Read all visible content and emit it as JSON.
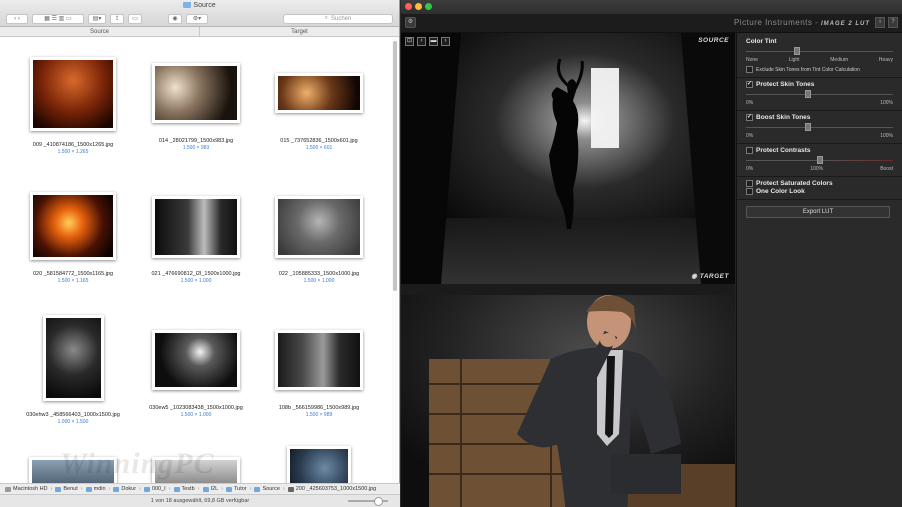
{
  "finder": {
    "title": "Source",
    "search_placeholder": "Suchen",
    "panes": [
      "Source",
      "Target"
    ],
    "files": [
      {
        "name": "009 _410874186_1500x1265.jpg",
        "dims": "1.500 × 1.265"
      },
      {
        "name": "014 _28021799_1500x983.jpg",
        "dims": "1.500 × 983"
      },
      {
        "name": "015 _737652836_1500x601.jpg",
        "dims": "1.500 × 601"
      },
      {
        "name": "020 _581584772_1500x1165.jpg",
        "dims": "1.500 × 1.165"
      },
      {
        "name": "021 _476690812_l2l_1500x1000.jpg",
        "dims": "1.500 × 1.000"
      },
      {
        "name": "022 _105885333_1500x1000.jpg",
        "dims": "1.500 × 1.000"
      },
      {
        "name": "030ehw3 _458566403_1000x1500.jpg",
        "dims": "1.000 × 1.500"
      },
      {
        "name": "030ew5 _1023083438_1500x1000.jpg",
        "dims": "1.500 × 1.000"
      },
      {
        "name": "108b _566159986_1500x989.jpg",
        "dims": "1.500 × 989"
      }
    ],
    "path": [
      "Macintosh HD",
      "Benut",
      "mdin",
      "Dokur",
      "000_I",
      "Testb",
      "I2L",
      "Tutor",
      "Source",
      "200 _425603753_1000x1500.jpg"
    ],
    "status": "1 von 18 ausgewählt, 69,8 GB verfügbar",
    "watermark": "WinningPC"
  },
  "lut": {
    "brand": "Picture Instruments",
    "product": "IMAGE 2 LUT",
    "header_buttons": [
      "i",
      "?"
    ],
    "source_label": "SOURCE",
    "target_label": "TARGET",
    "panel": {
      "color_tint": {
        "title": "Color Tint",
        "labels": [
          "None",
          "Light",
          "Medium",
          "Heavy"
        ],
        "value": 0.35,
        "exclude_label": "Exclude Skin Tones from Tint Color Calculation",
        "exclude_checked": false
      },
      "protect_skin": {
        "title": "Protect Skin Tones",
        "checked": true,
        "min": "0%",
        "max": "100%",
        "value": 0.42
      },
      "boost_skin": {
        "title": "Boost Skin Tones",
        "checked": true,
        "min": "0%",
        "max": "100%",
        "value": 0.42
      },
      "protect_contrasts": {
        "title": "Protect Contrasts",
        "checked": false,
        "min": "0%",
        "mid": "100%",
        "max": "Boost",
        "value": 0.5
      },
      "protect_saturated": {
        "title": "Protect Saturated Colors",
        "checked": false
      },
      "one_color_look": {
        "title": "One Color Look",
        "checked": false
      },
      "export_label": "Export LUT"
    }
  },
  "colors": {
    "finder_bg": "#ffffff",
    "lut_bg": "#232323",
    "link_blue": "#3a7bd5"
  }
}
